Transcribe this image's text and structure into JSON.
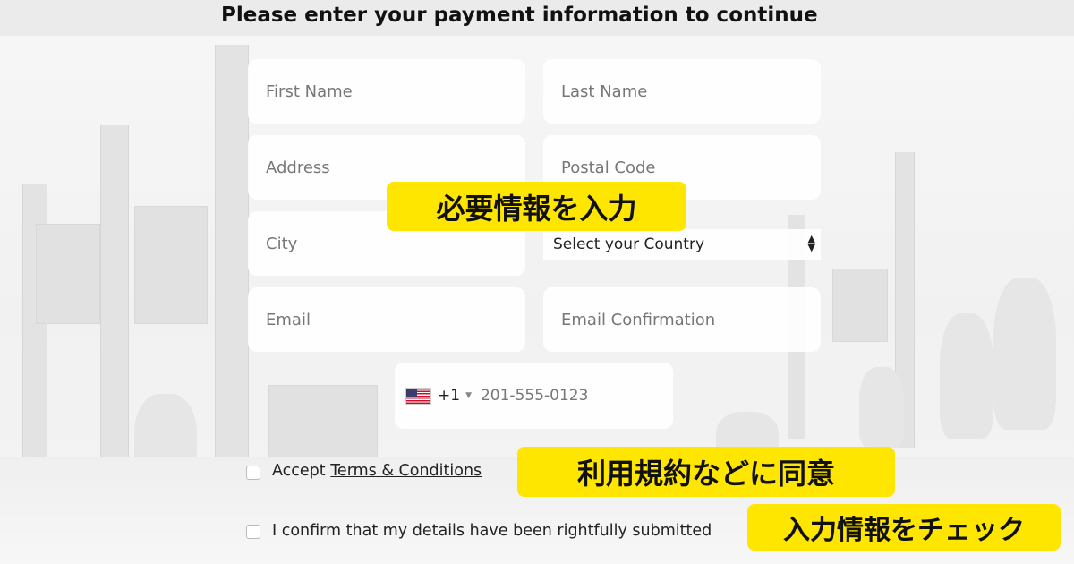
{
  "heading": "Please enter your payment information to continue",
  "form": {
    "first_name_placeholder": "First Name",
    "last_name_placeholder": "Last Name",
    "address_placeholder": "Address",
    "postal_code_placeholder": "Postal Code",
    "city_placeholder": "City",
    "country_select": "Select your Country",
    "email_placeholder": "Email",
    "email_confirm_placeholder": "Email Confirmation",
    "phone": {
      "flag_icon": "us-flag-icon",
      "dial_code": "+1",
      "placeholder": "201-555-0123"
    },
    "accept_prefix": "Accept ",
    "terms_link": "Terms & Conditions",
    "confirm_label": "I confirm that my details have been rightfully submitted"
  },
  "callouts": {
    "enter_info": "必要情報を入力",
    "agree_terms": "利用規約などに同意",
    "check_info": "入力情報をチェック"
  },
  "colors": {
    "callout_bg": "#ffe600",
    "heading": "#111111"
  }
}
